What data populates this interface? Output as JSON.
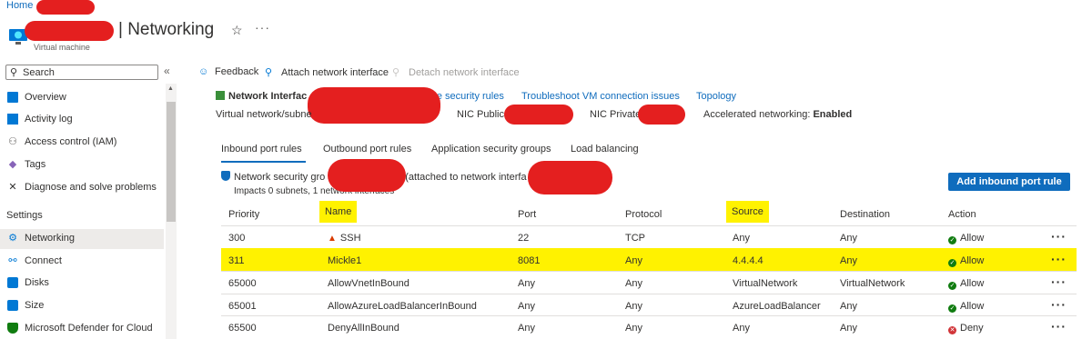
{
  "header": {
    "breadcrumb_home": "Home",
    "title": "| Networking",
    "subtitle": "Virtual machine"
  },
  "sidebar": {
    "search_placeholder": "Search",
    "settings_heading": "Settings",
    "items": [
      {
        "label": "Overview",
        "icon": "overview-icon",
        "color": "#0078d4"
      },
      {
        "label": "Activity log",
        "icon": "activity-log-icon",
        "color": "#0078d4"
      },
      {
        "label": "Access control (IAM)",
        "icon": "iam-icon",
        "color": "#605e5c"
      },
      {
        "label": "Tags",
        "icon": "tag-icon",
        "color": "#8764b8"
      },
      {
        "label": "Diagnose and solve problems",
        "icon": "wrench-icon",
        "color": "#323130"
      },
      {
        "label": "Networking",
        "icon": "networking-icon",
        "color": "#0078d4"
      },
      {
        "label": "Connect",
        "icon": "connect-icon",
        "color": "#0078d4"
      },
      {
        "label": "Disks",
        "icon": "disk-icon",
        "color": "#0078d4"
      },
      {
        "label": "Size",
        "icon": "size-icon",
        "color": "#0078d4"
      },
      {
        "label": "Microsoft Defender for Cloud",
        "icon": "defender-icon",
        "color": "#107c10"
      }
    ]
  },
  "toolbar": {
    "feedback": "Feedback",
    "attach": "Attach network interface",
    "detach": "Detach network interface"
  },
  "network_interface": {
    "label": "Network Interfac",
    "effective_rules": "Effective security rules",
    "troubleshoot": "Troubleshoot VM connection issues",
    "topology": "Topology",
    "vnet_label": "Virtual network/subne",
    "nic_public": "NIC Public I",
    "nic_private": "NIC Private I",
    "accel_label": "Accelerated networking:",
    "accel_value": "Enabled"
  },
  "tabs": [
    "Inbound port rules",
    "Outbound port rules",
    "Application security groups",
    "Load balancing"
  ],
  "nsg": {
    "prefix": "Network security gro",
    "suffix": "(attached to network interfa",
    "impacts": "Impacts 0 subnets, 1 network interfaces",
    "add_button": "Add inbound port rule"
  },
  "table": {
    "headers": {
      "priority": "Priority",
      "name": "Name",
      "port": "Port",
      "protocol": "Protocol",
      "source": "Source",
      "destination": "Destination",
      "action": "Action"
    },
    "rows": [
      {
        "priority": "300",
        "name": "SSH",
        "port": "22",
        "protocol": "TCP",
        "source": "Any",
        "destination": "Any",
        "action": "Allow"
      },
      {
        "priority": "311",
        "name": "Mickle1",
        "port": "8081",
        "protocol": "Any",
        "source": "4.4.4.4",
        "destination": "Any",
        "action": "Allow"
      },
      {
        "priority": "65000",
        "name": "AllowVnetInBound",
        "port": "Any",
        "protocol": "Any",
        "source": "VirtualNetwork",
        "destination": "VirtualNetwork",
        "action": "Allow"
      },
      {
        "priority": "65001",
        "name": "AllowAzureLoadBalancerInBound",
        "port": "Any",
        "protocol": "Any",
        "source": "AzureLoadBalancer",
        "destination": "Any",
        "action": "Allow"
      },
      {
        "priority": "65500",
        "name": "DenyAllInBound",
        "port": "Any",
        "protocol": "Any",
        "source": "Any",
        "destination": "Any",
        "action": "Deny"
      }
    ]
  },
  "colors": {
    "accent": "#0f6cbd",
    "highlight": "#fff200",
    "allow": "#107c10",
    "deny": "#d13438",
    "redaction": "#e41f1f"
  }
}
